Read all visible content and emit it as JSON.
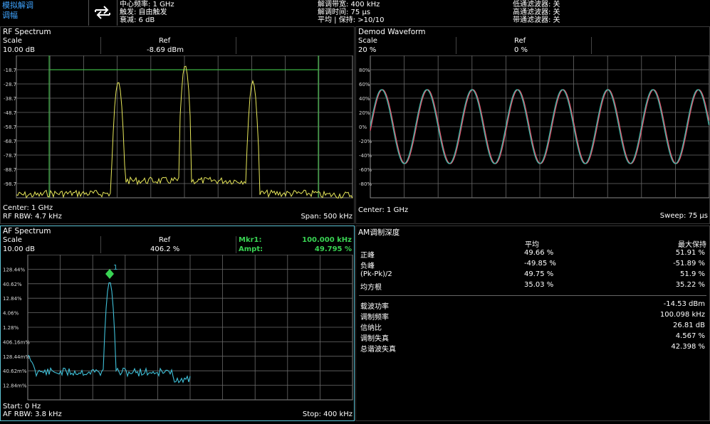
{
  "mode": {
    "line1": "模拟解调",
    "line2": "调幅"
  },
  "header": {
    "center_freq": "中心频率: 1 GHz",
    "trigger": "触发: 自由触发",
    "attenuation": "衰减: 6 dB",
    "demod_bw": "解调带宽: 400 kHz",
    "demod_time": "解调时间: 75 μs",
    "average_hold": "平均 | 保持: >10/10",
    "lpf": "低通滤波器: 关",
    "hpf": "高通滤波器: 关",
    "bpf": "带通滤波器: 关"
  },
  "rf": {
    "title": "RF Spectrum",
    "scale_label": "Scale",
    "scale_value": "10.00 dB",
    "ref_label": "Ref",
    "ref_value": "-8.69 dBm",
    "y_ticks": [
      "-18.7",
      "-28.7",
      "-38.7",
      "-48.7",
      "-58.7",
      "-68.7",
      "-78.7",
      "-88.7",
      "-98.7"
    ],
    "center": "Center: 1 GHz",
    "rbw": "RF RBW: 4.7 kHz",
    "span": "Span: 500 kHz",
    "trace_color": "#e8e85a",
    "limit_color": "#3cb043"
  },
  "demod": {
    "title": "Demod Waveform",
    "scale_label": "Scale",
    "scale_value": "20 %",
    "ref_label": "Ref",
    "ref_value": "0 %",
    "y_ticks": [
      "80%",
      "60%",
      "40%",
      "20%",
      "0%",
      "-20%",
      "-40%",
      "-60%",
      "-80%"
    ],
    "center": "Center: 1 GHz",
    "sweep": "Sweep: 75 μs",
    "trace_colors": [
      "#e8556e",
      "#3fb8a8"
    ]
  },
  "af": {
    "title": "AF Spectrum",
    "scale_label": "Scale",
    "scale_value": "10.00 dB",
    "ref_label": "Ref",
    "ref_value": "406.2 %",
    "mkr_label": "Mkr1:",
    "mkr_value": "100.000 kHz",
    "ampt_label": "Ampt:",
    "ampt_value": "49.795 %",
    "marker_number": "1",
    "y_ticks": [
      "128.44%",
      "40.62%",
      "12.84%",
      "4.06%",
      "1.28%",
      "406.16m%",
      "128.44m%",
      "40.62m%",
      "12.84m%"
    ],
    "start": "Start: 0 Hz",
    "rbw": "AF RBW: 3.8 kHz",
    "stop": "Stop: 400 kHz",
    "trace_color": "#3fc0d8"
  },
  "am": {
    "title": "AM调制深度",
    "col_avg": "平均",
    "col_max": "最大保持",
    "rows": [
      {
        "label": "正峰",
        "avg": "49.66 %",
        "max": "51.91 %"
      },
      {
        "label": "负峰",
        "avg": "-49.85 %",
        "max": "-51.89 %"
      },
      {
        "label": "(Pk-Pk)/2",
        "avg": "49.75 %",
        "max": "51.9 %"
      },
      {
        "label": "均方根",
        "avg": "35.03 %",
        "max": "35.22 %"
      }
    ],
    "metrics": [
      {
        "label": "载波功率",
        "value": "-14.53 dBm"
      },
      {
        "label": "调制频率",
        "value": "100.098 kHz"
      },
      {
        "label": "信纳比",
        "value": "26.81 dB"
      },
      {
        "label": "调制失真",
        "value": "4.567 %"
      },
      {
        "label": "总谐波失真",
        "value": "42.398 %"
      }
    ]
  }
}
